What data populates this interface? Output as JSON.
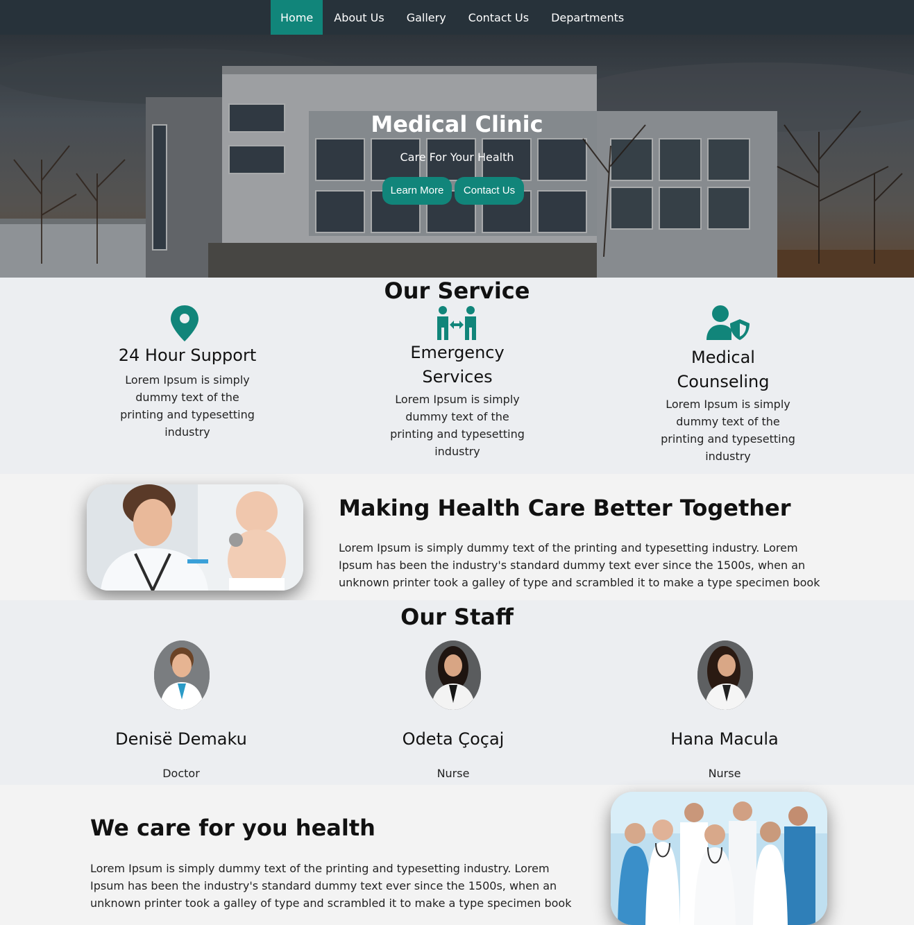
{
  "nav": {
    "items": [
      {
        "label": "Home"
      },
      {
        "label": "About Us"
      },
      {
        "label": "Gallery"
      },
      {
        "label": "Contact Us"
      },
      {
        "label": "Departments"
      }
    ],
    "active": "Home"
  },
  "hero": {
    "title": "Medical Clinic",
    "subtitle": "Care For Your Health",
    "learn_more": "Learn More",
    "contact_us": "Contact Us"
  },
  "services": {
    "title": "Our Service",
    "items": [
      {
        "icon": "location-pin-icon",
        "title": "24 Hour Support",
        "text": "Lorem Ipsum is simply dummy text of the printing and typesetting industry"
      },
      {
        "icon": "people-arrows-icon",
        "title": "Emergency Services",
        "text": "Lorem Ipsum is simply dummy text of the printing and typesetting industry"
      },
      {
        "icon": "user-shield-icon",
        "title": "Medical Counseling",
        "text": "Lorem Ipsum is simply dummy text of the printing and typesetting industry"
      }
    ]
  },
  "about": {
    "title": "Making Health Care Better Together",
    "text": "Lorem Ipsum is simply dummy text of the printing and typesetting industry. Lorem Ipsum has been the industry's standard dummy text ever since the 1500s, when an unknown printer took a galley of type and scrambled it to make a type specimen book"
  },
  "staff": {
    "title": "Our Staff",
    "members": [
      {
        "name": "Denisë Demaku",
        "role": "Doctor"
      },
      {
        "name": "Odeta Çoçaj",
        "role": "Nurse"
      },
      {
        "name": "Hana Macula",
        "role": "Nurse"
      }
    ]
  },
  "care": {
    "title": "We care for you health",
    "text": "Lorem Ipsum is simply dummy text of the printing and typesetting industry. Lorem Ipsum has been the industry's standard dummy text ever since the 1500s, when an unknown printer took a galley of type and scrambled it to make a type specimen book"
  },
  "colors": {
    "accent": "#11857a",
    "nav_bg": "#27323a",
    "section_bg": "#eceef1",
    "alt_section_bg": "#f3f3f3"
  }
}
